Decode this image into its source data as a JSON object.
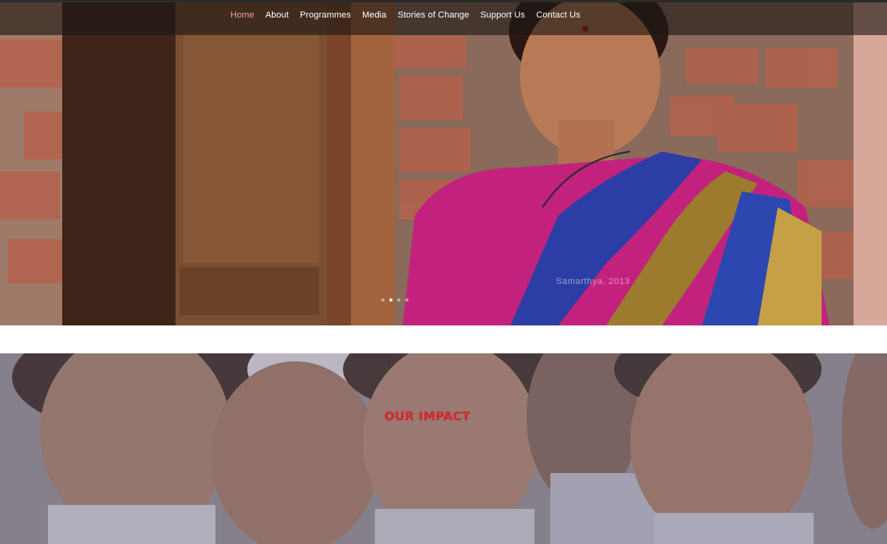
{
  "nav": {
    "items": [
      {
        "label": "Home",
        "active": true
      },
      {
        "label": "About"
      },
      {
        "label": "Programmes"
      },
      {
        "label": "Media"
      },
      {
        "label": "Stories of Change"
      },
      {
        "label": "Support Us"
      },
      {
        "label": "Contact Us"
      }
    ],
    "active_color": "#f39aa8"
  },
  "hero": {
    "caption": "Samarthya, 2013",
    "slide_count": 4,
    "active_slide": 1
  },
  "impact": {
    "title": "OUR IMPACT",
    "title_color": "#d52a2e"
  }
}
